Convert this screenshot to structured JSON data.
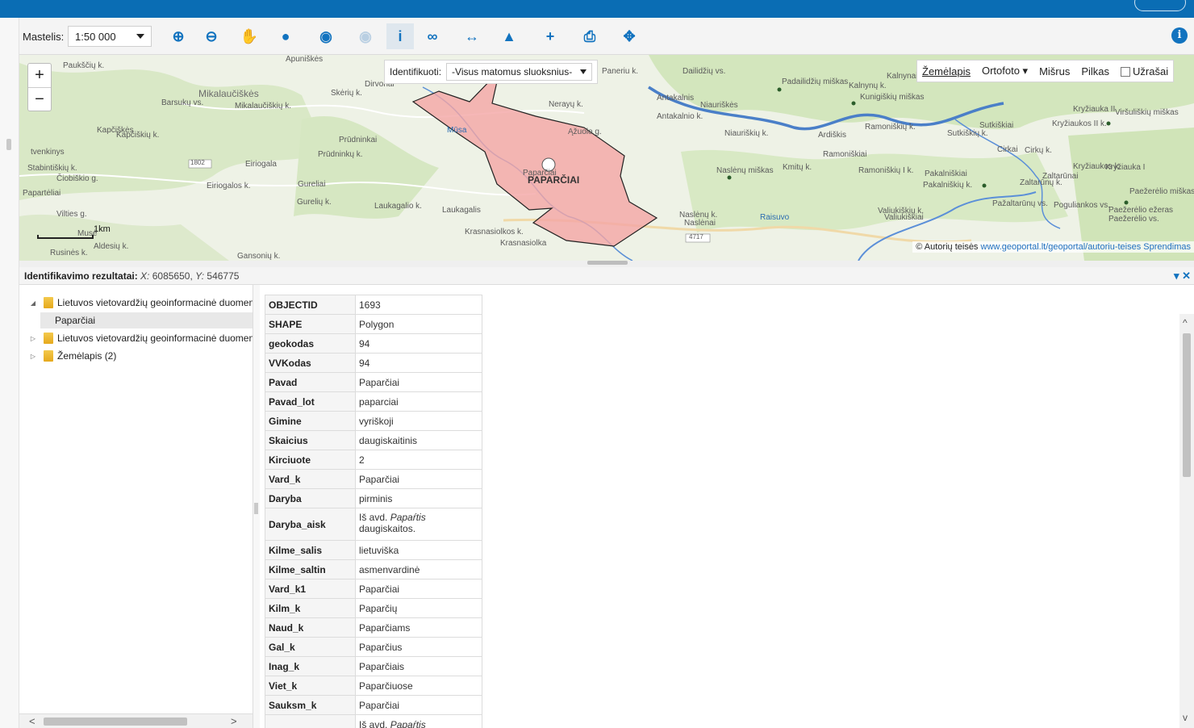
{
  "toolbar": {
    "scale_label": "Mastelis:",
    "scale_value": "1:50 000",
    "tools": [
      {
        "name": "zoom-in-icon",
        "glyph": "⊕"
      },
      {
        "name": "zoom-out-icon",
        "glyph": "⊖"
      },
      {
        "name": "pan-hand-icon",
        "glyph": "✋"
      },
      {
        "name": "globe-icon",
        "glyph": "●"
      },
      {
        "name": "back-icon",
        "glyph": "◉"
      },
      {
        "name": "forward-icon",
        "glyph": "◉"
      },
      {
        "name": "identify-info-icon",
        "glyph": "i"
      },
      {
        "name": "link-icon",
        "glyph": "∞"
      },
      {
        "name": "measure-distance-icon",
        "glyph": "↔"
      },
      {
        "name": "elevation-profile-icon",
        "glyph": "▲"
      },
      {
        "name": "add-icon",
        "glyph": "+"
      },
      {
        "name": "print-icon",
        "glyph": "⎙"
      },
      {
        "name": "locate-crosshair-icon",
        "glyph": "✥"
      }
    ],
    "info_glyph": "i"
  },
  "map": {
    "identify_label": "Identifikuoti:",
    "identify_value": "-Visus matomus sluoksnius-",
    "layers": [
      "Žemėlapis",
      "Ortofoto",
      "Mišrus",
      "Pilkas"
    ],
    "labels_toggle": "Užrašai",
    "scale_bar": "1km",
    "attribution_prefix": "© Autorių teisės",
    "attribution_link": "www.geoportal.lt/geoportal/autoriu-teises",
    "attribution_suffix": "Sprendimas",
    "place_names": {
      "p1": "Paukščių k.",
      "p2": "Mikalaučiškės",
      "p3": "Mikalaučiškių k.",
      "p4": "Barsukų vs.",
      "p5": "Kapčiškės",
      "p6": "Kapčiškių k.",
      "p7": "Prūdninkai",
      "p8": "Prūdninkų k.",
      "p9": "Eiriogala",
      "p10": "Eiriogalos k.",
      "p11": "Gureliai",
      "p12": "Gurelių k.",
      "p13": "Laukagalio k.",
      "p14": "Laukagalis",
      "p15": "Krasnasiolkos k.",
      "p16": "Krasnasiolka",
      "p17": "PAPARČIAI",
      "p18": "Paparčiai",
      "p19": "Antakalnis",
      "p20": "Antakalnio k.",
      "p21": "Niauriškės",
      "p22": "Niauriškių k.",
      "p23": "Dailidžių vs.",
      "p24": "Padailidžių miškas",
      "p25": "Kalnynai",
      "p26": "Kalnynų k.",
      "p27": "Kunigiškių miškas",
      "p28": "Nerayų k.",
      "p29": "Ardiškis",
      "p30": "Ramoniškiai",
      "p31": "Ramoniškių k.",
      "p32": "Sutkiškiai",
      "p33": "Sutkiškių k.",
      "p34": "Naslėnų miškas",
      "p35": "Kmitų k.",
      "p36": "Pakalniškiai",
      "p37": "Pakalniškių k.",
      "p38": "Zaltarūnai",
      "p39": "Zaltarūnų k.",
      "p40": "Kryžiauka II",
      "p41": "Kryžiaukos II k.",
      "p42": "Viršuliškių miškas",
      "p43": "Cirkai",
      "p44": "Cirkų k.",
      "p45": "Kryžiaukos k.",
      "p46": "Kryžiauka I",
      "p47": "Pažaltarūnų vs.",
      "p48": "Poguliankos vs.",
      "p49": "Paežerėlio ežeras",
      "p50": "Paežerėlio vs.",
      "p51": "Paežerėlio miškas",
      "p52": "Valiukiškių k.",
      "p53": "Valiukiškiai",
      "p54": "Naslėnų k.",
      "p55": "Naslėnai",
      "p56": "Stabintiškių k.",
      "p57": "Čiobiškio g.",
      "p58": "Papartėliai",
      "p59": "Vilties g.",
      "p60": "Rusinės k.",
      "p61": "Aldesių k.",
      "p62": "Gansonių k.",
      "p63": "Skėrių k.",
      "p64": "Dirvonai",
      "p65": "Apuniškės",
      "p66": "Paneriu k.",
      "p67": "Ąžuolo g.",
      "p68": "Mūsa",
      "p69": "Raisuvo",
      "p70": "1802",
      "p71": "4717",
      "p72": "tvenkinys",
      "p73": "Ramoniškių I k.",
      "p74": "Musė"
    }
  },
  "results": {
    "title": "Identifikavimo rezultatai:",
    "x_label": "X:",
    "x_value": "6085650,",
    "y_label": "Y:",
    "y_value": "546775",
    "collapse_glyph": "▾",
    "close_glyph": "✕"
  },
  "tree": {
    "items": [
      {
        "label": "Lietuvos vietovardžių geoinformacinė duomenų",
        "expander": "◢"
      },
      {
        "label": "Paparčiai"
      },
      {
        "label": "Lietuvos vietovardžių geoinformacinė duomenų",
        "expander": "▷"
      },
      {
        "label": "Žemėlapis (2)",
        "expander": "▷"
      }
    ],
    "scroll_left": "<",
    "scroll_right": ">"
  },
  "attributes": [
    {
      "key": "OBJECTID",
      "value": "1693"
    },
    {
      "key": "SHAPE",
      "value": "Polygon"
    },
    {
      "key": "geokodas",
      "value": "94"
    },
    {
      "key": "VVKodas",
      "value": "94"
    },
    {
      "key": "Pavad",
      "value": "Paparčiai"
    },
    {
      "key": "Pavad_lot",
      "value": "paparciai"
    },
    {
      "key": "Gimine",
      "value": "vyriškoji"
    },
    {
      "key": "Skaicius",
      "value": "daugiskaitinis"
    },
    {
      "key": "Kirciuote",
      "value": "2"
    },
    {
      "key": "Vard_k",
      "value": "Paparčiai"
    },
    {
      "key": "Daryba",
      "value": "pirminis"
    },
    {
      "key": "Daryba_aisk",
      "value_pre": "Iš avd. ",
      "value_em": "Papaŕtis",
      "value_post": " daugiskaitos."
    },
    {
      "key": "Kilme_salis",
      "value": "lietuviška"
    },
    {
      "key": "Kilme_saltin",
      "value": "asmenvardinė"
    },
    {
      "key": "Vard_k1",
      "value": "Paparčiai"
    },
    {
      "key": "Kilm_k",
      "value": "Paparčių"
    },
    {
      "key": "Naud_k",
      "value": "Paparčiams"
    },
    {
      "key": "Gal_k",
      "value": "Paparčius"
    },
    {
      "key": "Inag_k",
      "value": "Paparčiais"
    },
    {
      "key": "Viet_k",
      "value": "Paparčiuose"
    },
    {
      "key": "Sauksm_k",
      "value": "Paparčiai"
    },
    {
      "key": "",
      "value_pre": "Iš avd. ",
      "value_em": "Papaŕtis",
      "value_post": ""
    }
  ]
}
